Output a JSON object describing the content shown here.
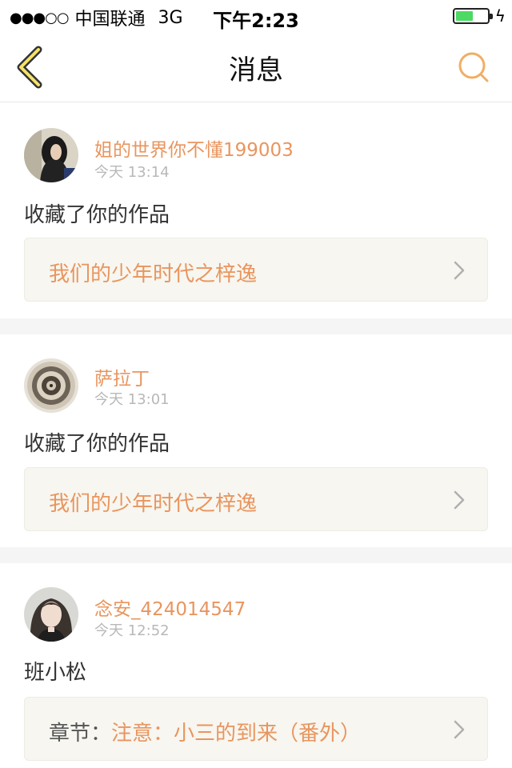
{
  "status_bar": {
    "signal": "●●●○○",
    "carrier": "中国联通",
    "network": "3G",
    "time": "下午2:23",
    "battery_level": 0.55,
    "battery_color": "#4cd964"
  },
  "nav": {
    "title": "消息",
    "back_icon": "chevron-left-icon",
    "search_icon": "search-icon",
    "accent": "#f0ae66"
  },
  "messages": [
    {
      "username": "姐的世界你不懂199003",
      "time": "今天 13:14",
      "action": "收藏了你的作品",
      "work_prefix": "",
      "work_title": "我们的少年时代之梓逸"
    },
    {
      "username": "萨拉丁",
      "time": "今天 13:01",
      "action": "收藏了你的作品",
      "work_prefix": "",
      "work_title": "我们的少年时代之梓逸"
    },
    {
      "username": "念安_424014547",
      "time": "今天 12:52",
      "action": "班小松",
      "work_prefix": "章节：",
      "work_title": "注意：小三的到来（番外）"
    }
  ],
  "colors": {
    "username": "#e9955e",
    "timestamp": "#b8b8b8",
    "card_bg": "#f7f6f0"
  }
}
